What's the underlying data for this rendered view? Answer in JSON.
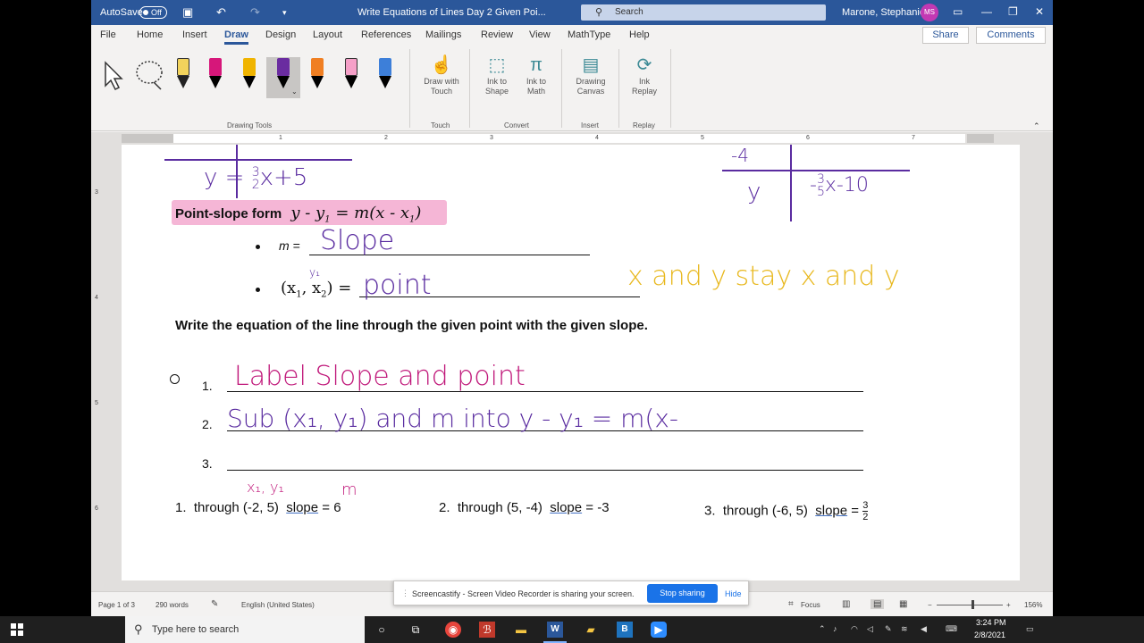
{
  "titlebar": {
    "autosave_label": "AutoSave",
    "autosave_state": "Off",
    "doc_title": "Write Equations of Lines Day 2 Given Poi...",
    "search_placeholder": "Search",
    "user_name": "Marone, Stephanie",
    "user_initials": "MS"
  },
  "tabs": [
    "File",
    "Home",
    "Insert",
    "Draw",
    "Design",
    "Layout",
    "References",
    "Mailings",
    "Review",
    "View",
    "MathType",
    "Help"
  ],
  "active_tab": "Draw",
  "share_label": "Share",
  "comments_label": "Comments",
  "ribbon": {
    "groups": {
      "drawing_tools": "Drawing Tools",
      "touch": "Touch",
      "convert": "Convert",
      "insert": "Insert",
      "replay": "Replay"
    },
    "draw_with_touch": [
      "Draw with",
      "Touch"
    ],
    "ink_to_shape": [
      "Ink to",
      "Shape"
    ],
    "ink_to_math": [
      "Ink to",
      "Math"
    ],
    "drawing_canvas": [
      "Drawing",
      "Canvas"
    ],
    "ink_replay": [
      "Ink",
      "Replay"
    ],
    "pen_colors": [
      "#f2d35c",
      "#d6177a",
      "#f0b400",
      "#6a2ca0",
      "#f07f22",
      "#f5a0c8",
      "#3d7fd9"
    ]
  },
  "ruler": {
    "h_numbers": [
      "1",
      "1",
      "2",
      "3",
      "4",
      "5",
      "6",
      "7"
    ],
    "v_numbers": [
      "3",
      "4",
      "5",
      "6"
    ]
  },
  "document": {
    "ps_label": "Point-slope form",
    "ps_formula": "y - y",
    "ps_sub1": "1",
    "ps_eq": " = m(x - x",
    "ps_sub2": "1",
    "ps_close": ")",
    "m_label": "m =",
    "pt_label_open": "(x",
    "pt_sub1": "1",
    "pt_comma": ", x",
    "pt_sub2": "2",
    "pt_close": ") =",
    "instruction": "Write the equation of the line through the given point with the given slope.",
    "steps": [
      "1.",
      "2.",
      "3."
    ],
    "problems": [
      {
        "num": "1.",
        "text": "through (-2, 5)",
        "slope_word": "slope",
        "rest": " = 6"
      },
      {
        "num": "2.",
        "text": "through (5, -4)",
        "slope_word": "slope",
        "rest": " = -3"
      },
      {
        "num": "3.",
        "text": "through (-6, 5)",
        "slope_word": "slope",
        "rest": " = "
      }
    ],
    "frac_num": "3",
    "frac_den": "2",
    "ink": {
      "top_left_eq": "y = ",
      "top_left_frac_num": "3",
      "top_left_frac_den": "2",
      "top_left_rest": "x+5",
      "top_right_top": "-4",
      "top_right_eq": "y",
      "top_right_frac_num": "3",
      "top_right_frac_den": "5",
      "top_right_rest": "x-10",
      "top_right_neg": "-",
      "slope_word": "Slope",
      "point_word": "point",
      "y1_annot": "y₁",
      "stay_note": "x and y  stay  x and y",
      "step1": "Label  Slope  and  point",
      "step2": "Sub  (x₁, y₁)  and  m  into  y - y₁ = m(x-",
      "xy_annot": "x₁, y₁",
      "m_annot": "m"
    },
    "ink_colors": {
      "purple": "#5a2ca0",
      "gold": "#e8b81e",
      "magenta": "#c0187a"
    }
  },
  "statusbar": {
    "page": "Page 1 of 3",
    "words": "290 words",
    "language": "English (United States)",
    "focus": "Focus",
    "zoom": "156%"
  },
  "sharebar": {
    "message": "Screencastify - Screen Video Recorder is sharing your screen.",
    "stop": "Stop sharing",
    "hide": "Hide"
  },
  "taskbar": {
    "search_placeholder": "Type here to search",
    "time": "3:24 PM",
    "date": "2/8/2021"
  }
}
